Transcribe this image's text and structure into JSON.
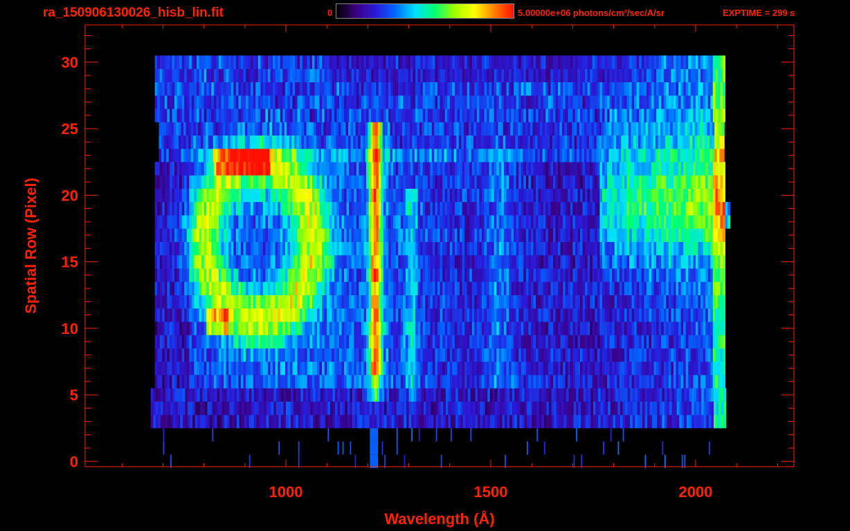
{
  "header": {
    "filename": "ra_150906130026_hisb_lin.fit",
    "colorbar_min": "0",
    "colorbar_max_label": "5.00000e+06 photons/cm²/sec/A/sr",
    "exptime": "EXPTIME = 299 s"
  },
  "colors": {
    "text": "#ff2200",
    "axes": "#ff2200",
    "background": "#000000",
    "colormap": [
      "#000000",
      "#3a0080",
      "#2a1ad8",
      "#0068ff",
      "#00e0ff",
      "#00ff70",
      "#a0ff00",
      "#ffff00",
      "#ff8000",
      "#ff1000"
    ]
  },
  "chart_data": {
    "type": "heatmap",
    "title": "ra_150906130026_hisb_lin.fit",
    "xlabel": "Wavelength (Å)",
    "ylabel": "Spatial Row (Pixel)",
    "xlim": [
      510,
      2240
    ],
    "ylim": [
      -0.4,
      32.8
    ],
    "xticks": [
      1000,
      1500,
      2000
    ],
    "yticks": [
      0,
      5,
      10,
      15,
      20,
      25,
      30
    ],
    "colorbar": {
      "min": 0,
      "max": 5000000,
      "units": "photons/cm²/sec/A/sr"
    },
    "grid": false,
    "data_extent": {
      "wavelength": [
        680,
        2070
      ],
      "rows": [
        3,
        30
      ]
    },
    "features": [
      {
        "wavelength": 1216,
        "rows": [
          5,
          25
        ],
        "intensity": 0.88
      },
      {
        "wavelength": 1304,
        "rows": [
          5,
          20
        ],
        "intensity": 0.45
      },
      {
        "wavelength_range": [
          780,
          950
        ],
        "rows": [
          10,
          25
        ],
        "intensity": 0.7
      },
      {
        "wavelength_range": [
          1780,
          2070
        ],
        "rows": [
          17,
          23
        ],
        "intensity": 0.65
      }
    ]
  }
}
